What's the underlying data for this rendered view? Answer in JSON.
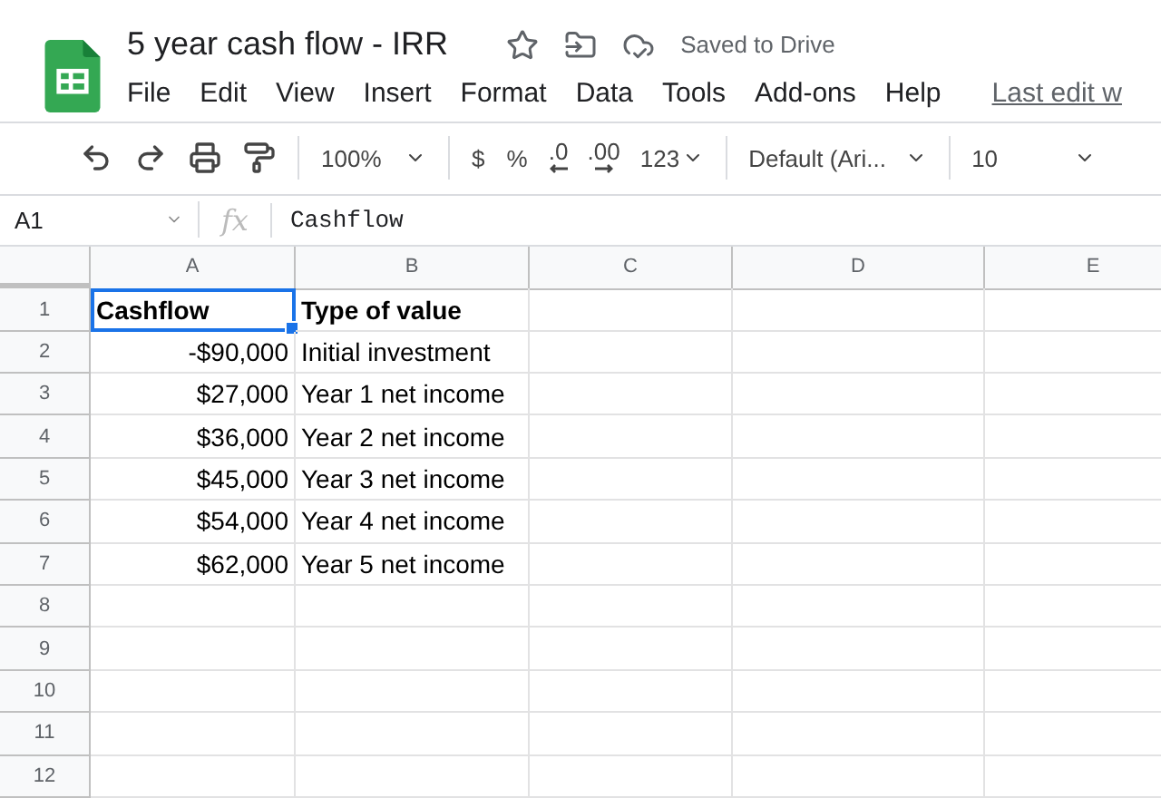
{
  "document": {
    "title": "5 year cash flow - IRR",
    "status": "Saved to Drive",
    "starred": false
  },
  "menu": [
    "File",
    "Edit",
    "View",
    "Insert",
    "Format",
    "Data",
    "Tools",
    "Add-ons",
    "Help"
  ],
  "last_edit": "Last edit w",
  "toolbar": {
    "zoom": "100%",
    "currency": "$",
    "percent": "%",
    "decrease_decimals": ".0",
    "increase_decimals": ".00",
    "more_formats": "123",
    "font": "Default (Ari...",
    "font_size": "10"
  },
  "formula_bar": {
    "cell": "A1",
    "fx": "fx",
    "value": "Cashflow"
  },
  "columns": [
    "A",
    "B",
    "C",
    "D",
    "E"
  ],
  "rows": [
    {
      "number": "1",
      "bold": true,
      "cells": [
        {
          "text": "Cashflow",
          "kind": "text",
          "selected": true
        },
        {
          "text": "Type of value",
          "kind": "text",
          "selected": false
        }
      ]
    },
    {
      "number": "2",
      "bold": false,
      "cells": [
        {
          "text": "-$90,000",
          "kind": "number",
          "selected": false
        },
        {
          "text": "Initial investment",
          "kind": "text",
          "selected": false
        }
      ]
    },
    {
      "number": "3",
      "bold": false,
      "cells": [
        {
          "text": "$27,000",
          "kind": "number",
          "selected": false
        },
        {
          "text": "Year 1 net income",
          "kind": "text",
          "selected": false
        }
      ]
    },
    {
      "number": "4",
      "bold": false,
      "cells": [
        {
          "text": "$36,000",
          "kind": "number",
          "selected": false
        },
        {
          "text": "Year 2 net income",
          "kind": "text",
          "selected": false
        }
      ]
    },
    {
      "number": "5",
      "bold": false,
      "cells": [
        {
          "text": "$45,000",
          "kind": "number",
          "selected": false
        },
        {
          "text": "Year 3 net income",
          "kind": "text",
          "selected": false
        }
      ]
    },
    {
      "number": "6",
      "bold": false,
      "cells": [
        {
          "text": "$54,000",
          "kind": "number",
          "selected": false
        },
        {
          "text": "Year 4 net income",
          "kind": "text",
          "selected": false
        }
      ]
    },
    {
      "number": "7",
      "bold": false,
      "cells": [
        {
          "text": "$62,000",
          "kind": "number",
          "selected": false
        },
        {
          "text": "Year 5 net income",
          "kind": "text",
          "selected": false
        }
      ]
    },
    {
      "number": "8",
      "cells": []
    },
    {
      "number": "9",
      "cells": []
    },
    {
      "number": "10",
      "cells": []
    },
    {
      "number": "11",
      "cells": []
    },
    {
      "number": "12",
      "cells": []
    }
  ]
}
